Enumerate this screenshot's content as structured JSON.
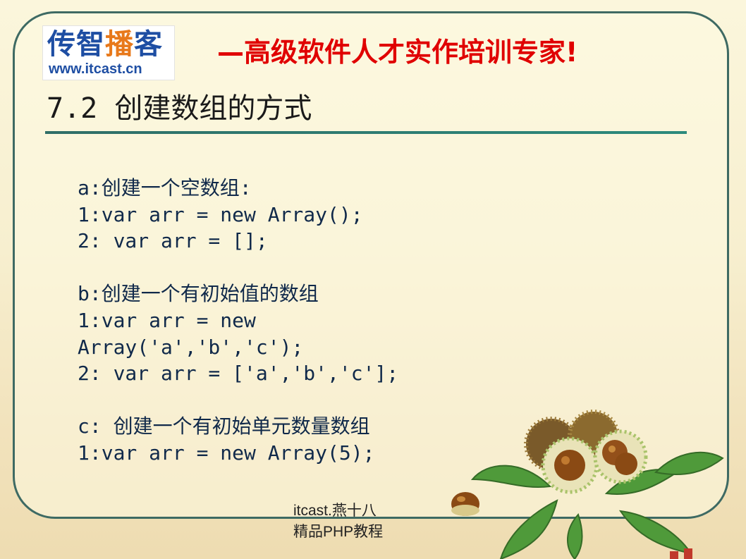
{
  "logo": {
    "name_part1": "传智",
    "name_part2": "播",
    "name_part3": "客",
    "url": "www.itcast.cn"
  },
  "slogan": "—高级软件人才实作培训专家!",
  "slide": {
    "title": "7.2 创建数组的方式"
  },
  "content": {
    "lines": [
      "a:创建一个空数组:",
      "1:var arr = new Array();",
      "2: var arr = [];",
      "",
      "b:创建一个有初始值的数组",
      "1:var arr = new",
      "Array('a','b','c');",
      "2: var arr = ['a','b','c'];",
      "",
      "c: 创建一个有初始单元数量数组",
      "1:var arr = new Array(5);"
    ]
  },
  "footer": {
    "line1": "itcast.燕十八",
    "line2": "精品PHP教程"
  },
  "colors": {
    "frame": "#3e6a63",
    "slogan": "#e00000",
    "logo_blue": "#1e4ea3",
    "logo_orange": "#e8791b",
    "code_text": "#10294a"
  },
  "decoration_icon": "chestnuts-with-leaves-icon"
}
